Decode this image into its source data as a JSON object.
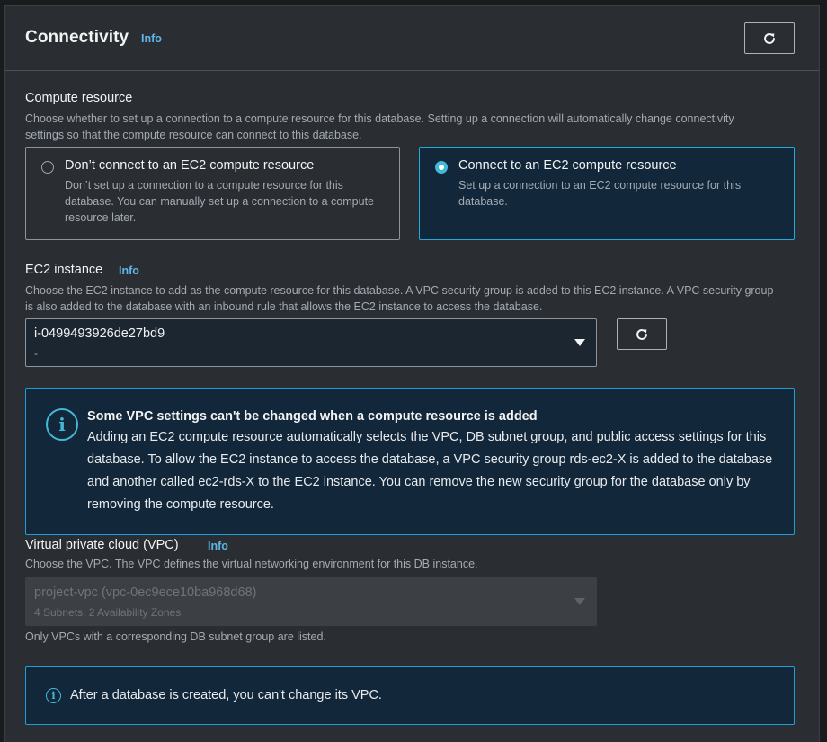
{
  "section": {
    "title": "Connectivity",
    "info_label": "Info"
  },
  "compute_resource": {
    "label": "Compute resource",
    "description": "Choose whether to set up a connection to a compute resource for this database. Setting up a connection will automatically change connectivity settings so that the compute resource can connect to this database.",
    "options": [
      {
        "title": "Don’t connect to an EC2 compute resource",
        "description": "Don’t set up a connection to a compute resource for this database. You can manually set up a connection to a compute resource later.",
        "selected": false
      },
      {
        "title": "Connect to an EC2 compute resource",
        "description": "Set up a connection to an EC2 compute resource for this database.",
        "selected": true
      }
    ]
  },
  "ec2_instance": {
    "label": "EC2 instance",
    "info_label": "Info",
    "description": "Choose the EC2 instance to add as the compute resource for this database. A VPC security group is added to this EC2 instance. A VPC security group is also added to the database with an inbound rule that allows the EC2 instance to access the database.",
    "selected_value": "i-0499493926de27bd9",
    "selected_sub": "-"
  },
  "vpc_alert": {
    "title": "Some VPC settings can't be changed when a compute resource is added",
    "body": "Adding an EC2 compute resource automatically selects the VPC, DB subnet group, and public access settings for this database. To allow the EC2 instance to access the database, a VPC security group rds-ec2-X is added to the database and another called ec2-rds-X to the EC2 instance. You can remove the new security group for the database only by removing the compute resource."
  },
  "vpc": {
    "label": "Virtual private cloud (VPC)",
    "info_label": "Info",
    "description": "Choose the VPC. The VPC defines the virtual networking environment for this DB instance.",
    "selected_value": "project-vpc (vpc-0ec9ece10ba968d68)",
    "selected_sub": "4 Subnets, 2 Availability Zones",
    "disabled": true,
    "hint": "Only VPCs with a corresponding DB subnet group are listed."
  },
  "vpc_notice": {
    "text": "After a database is created, you can't change its VPC."
  },
  "colors": {
    "accent": "#44b9d6",
    "info_link": "#5eb5e8",
    "panel_bg": "#2a2e33",
    "selected_tile_bg": "#12283a"
  },
  "icons": {
    "refresh": "refresh-icon",
    "caret": "caret-down-icon",
    "info": "info-circle-icon"
  }
}
